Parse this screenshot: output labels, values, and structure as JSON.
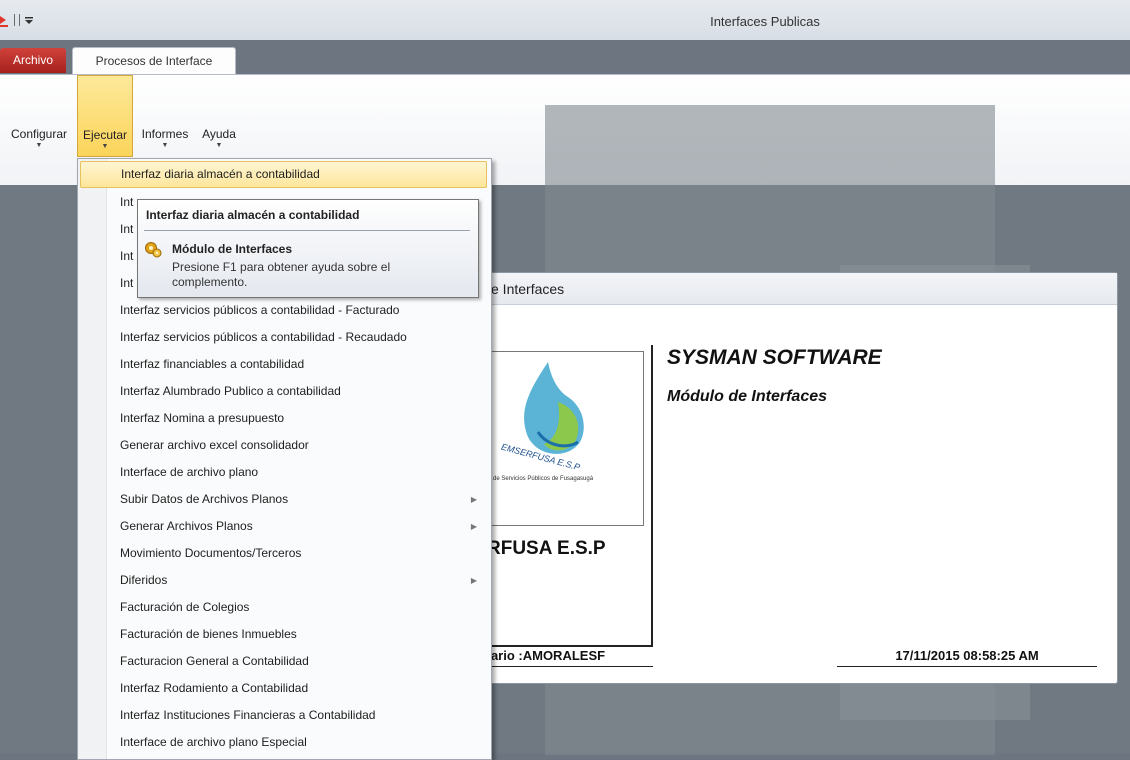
{
  "window": {
    "title": "Interfaces Publicas"
  },
  "tabs": {
    "archivo": "Archivo",
    "procesos": "Procesos de Interface"
  },
  "ribbon": {
    "buttons": [
      {
        "label": "Configurar"
      },
      {
        "label": "Ejecutar"
      },
      {
        "label": "Informes"
      },
      {
        "label": "Ayuda"
      }
    ]
  },
  "dropdown": {
    "items": [
      {
        "label": "Interfaz diaria almacén a contabilidad"
      },
      {
        "label": "Int"
      },
      {
        "label": "Int"
      },
      {
        "label": "Int"
      },
      {
        "label": "Int"
      },
      {
        "label": "Interfaz servicios públicos a contabilidad - Facturado"
      },
      {
        "label": "Interfaz servicios públicos a contabilidad - Recaudado"
      },
      {
        "label": "Interfaz financiables a contabilidad"
      },
      {
        "label": "Interfaz Alumbrado Publico a contabilidad"
      },
      {
        "label": "Interfaz Nomina a presupuesto"
      },
      {
        "label": "Generar archivo excel consolidador"
      },
      {
        "label": "Interface de archivo plano"
      },
      {
        "label": "Subir Datos de Archivos Planos"
      },
      {
        "label": "Generar Archivos Planos"
      },
      {
        "label": "Movimiento Documentos/Terceros"
      },
      {
        "label": "Diferidos"
      },
      {
        "label": "Facturación de Colegios"
      },
      {
        "label": "Facturación de bienes Inmuebles"
      },
      {
        "label": "Facturacion General a Contabilidad"
      },
      {
        "label": "Interfaz Rodamiento a Contabilidad"
      },
      {
        "label": "Interfaz Instituciones Financieras a Contabilidad"
      },
      {
        "label": "Interface de archivo plano Especial"
      }
    ]
  },
  "tooltip": {
    "title": "Interfaz diaria almacén a contabilidad",
    "heading": "Módulo de Interfaces",
    "body": "Presione F1 para obtener ayuda sobre el complemento."
  },
  "main_window": {
    "title": "e Interfaces",
    "company": "SYSMAN SOFTWARE",
    "module": "Módulo de Interfaces",
    "logo_text": "EMSERFUSA E.S.P",
    "logo_subtext": "a de Servicios Públicos de Fusagasugá",
    "logo_caption": "RFUSA E.S.P",
    "user_label": "uario  :AMORALESF",
    "datetime": "17/11/2015 08:58:25 AM"
  },
  "colors": {
    "archivo_tab": "#c0312b",
    "highlight": "#fde69b",
    "ribbon_active": "#fbd45a"
  }
}
